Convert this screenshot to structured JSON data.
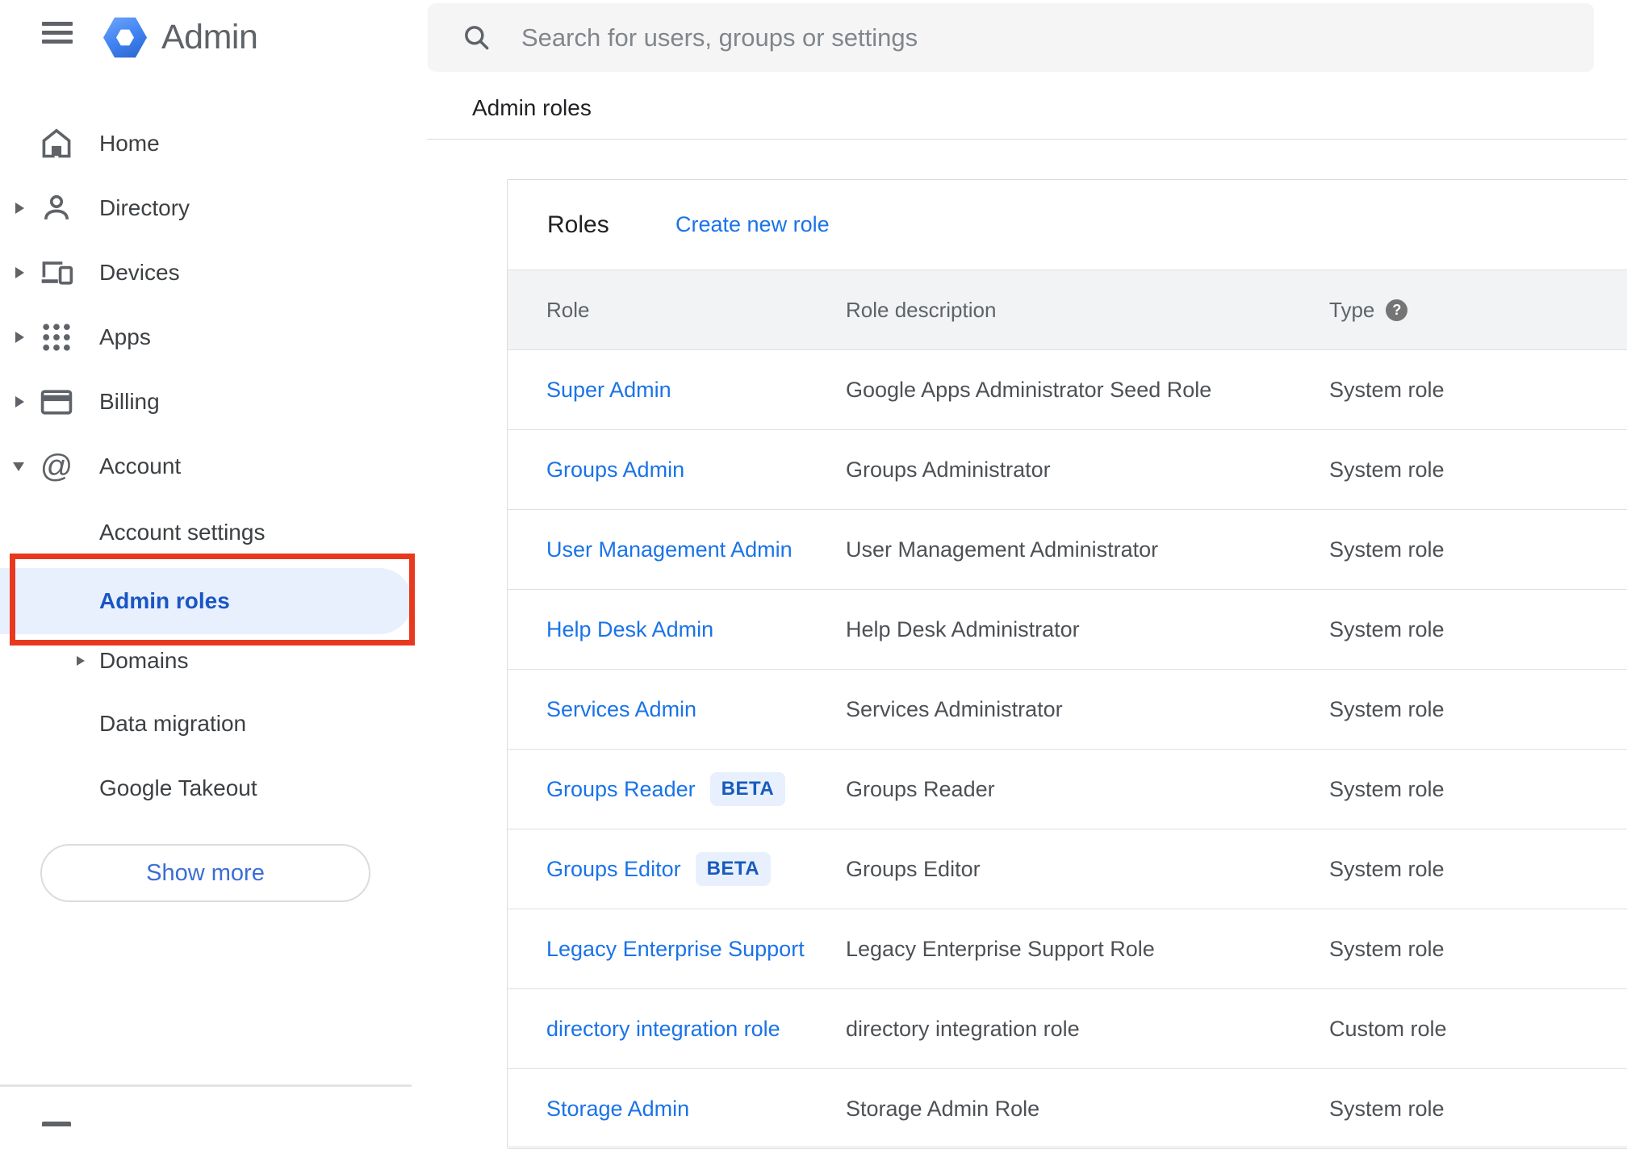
{
  "chrome": {
    "app_title": "Admin"
  },
  "search": {
    "placeholder": "Search for users, groups or settings"
  },
  "breadcrumb": {
    "label": "Admin roles"
  },
  "sidebar": {
    "items": [
      {
        "label": "Home"
      },
      {
        "label": "Directory"
      },
      {
        "label": "Devices"
      },
      {
        "label": "Apps"
      },
      {
        "label": "Billing"
      },
      {
        "label": "Account"
      },
      {
        "label": "Account settings"
      },
      {
        "label": "Admin roles",
        "selected": true
      },
      {
        "label": "Domains"
      },
      {
        "label": "Data migration"
      },
      {
        "label": "Google Takeout"
      }
    ],
    "show_more_label": "Show more"
  },
  "glyphs": {
    "at": "@",
    "help": "?"
  },
  "roles_panel": {
    "title": "Roles",
    "create_link": "Create new role",
    "columns": {
      "role": "Role",
      "description": "Role description",
      "type": "Type"
    },
    "beta_label": "BETA",
    "rows": [
      {
        "role": "Super Admin",
        "description": "Google Apps Administrator Seed Role",
        "type": "System role"
      },
      {
        "role": "Groups Admin",
        "description": "Groups Administrator",
        "type": "System role"
      },
      {
        "role": "User Management Admin",
        "description": "User Management Administrator",
        "type": "System role"
      },
      {
        "role": "Help Desk Admin",
        "description": "Help Desk Administrator",
        "type": "System role"
      },
      {
        "role": "Services Admin",
        "description": "Services Administrator",
        "type": "System role"
      },
      {
        "role": "Groups Reader",
        "description": "Groups Reader",
        "type": "System role",
        "beta": true
      },
      {
        "role": "Groups Editor",
        "description": "Groups Editor",
        "type": "System role",
        "beta": true
      },
      {
        "role": "Legacy Enterprise Support",
        "description": "Legacy Enterprise Support Role",
        "type": "System role"
      },
      {
        "role": "directory integration role",
        "description": "directory integration role",
        "type": "Custom role"
      },
      {
        "role": "Storage Admin",
        "description": "Storage Admin Role",
        "type": "System role"
      }
    ]
  },
  "colors": {
    "link_blue": "#1a73e8",
    "selected_text_blue": "#1956c4",
    "selected_pill_bg": "#e8f0fe",
    "annotation_red": "#e8391f",
    "beta_text_blue": "#185abc",
    "header_band_gray": "#f1f3f4",
    "search_bar_gray": "#f5f5f6",
    "icon_gray": "#5f6368"
  }
}
